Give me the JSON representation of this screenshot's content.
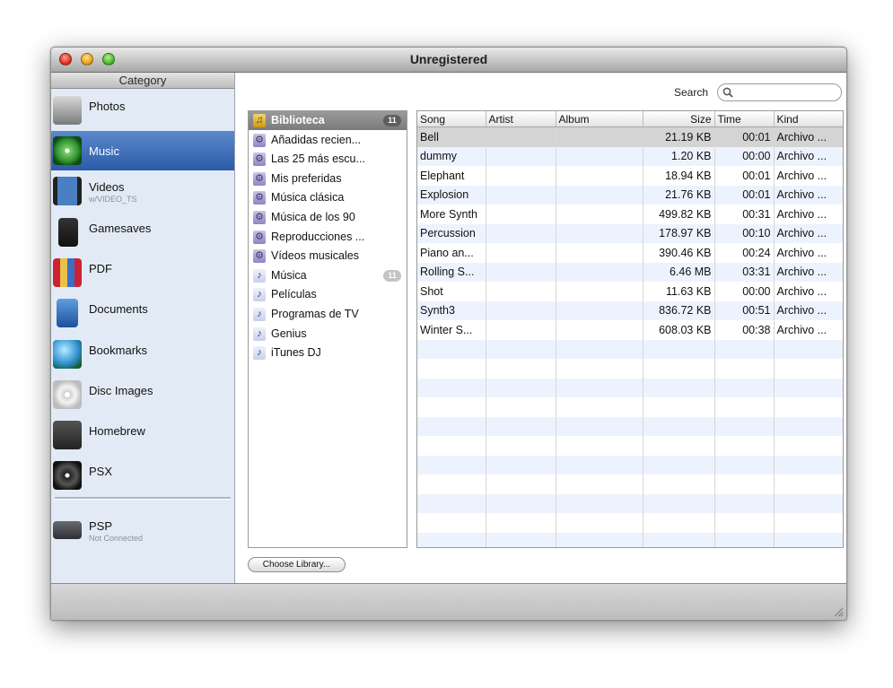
{
  "window": {
    "title": "Unregistered"
  },
  "sidebar": {
    "header": "Category",
    "items": [
      {
        "label": "Photos",
        "sublabel": "",
        "icon": "camera-icon"
      },
      {
        "label": "Music",
        "sublabel": "",
        "icon": "music-cd-icon",
        "selected": true
      },
      {
        "label": "Videos",
        "sublabel": "w/VIDEO_TS",
        "icon": "film-icon"
      },
      {
        "label": "Gamesaves",
        "sublabel": "",
        "icon": "memory-card-icon"
      },
      {
        "label": "PDF",
        "sublabel": "",
        "icon": "books-icon"
      },
      {
        "label": "Documents",
        "sublabel": "",
        "icon": "document-icon"
      },
      {
        "label": "Bookmarks",
        "sublabel": "",
        "icon": "globe-icon"
      },
      {
        "label": "Disc Images",
        "sublabel": "",
        "icon": "disc-icon"
      },
      {
        "label": "Homebrew",
        "sublabel": "",
        "icon": "clapper-icon"
      },
      {
        "label": "PSX",
        "sublabel": "",
        "icon": "vinyl-disc-icon"
      }
    ],
    "device": {
      "label": "PSP",
      "sublabel": "Not Connected",
      "icon": "psp-icon"
    }
  },
  "search": {
    "label": "Search",
    "value": "",
    "placeholder": ""
  },
  "library": {
    "items": [
      {
        "label": "Biblioteca",
        "badge": "11",
        "type": "library",
        "selected": true
      },
      {
        "label": "Añadidas recien...",
        "type": "smart"
      },
      {
        "label": "Las 25 más escu...",
        "type": "smart"
      },
      {
        "label": "Mis preferidas",
        "type": "smart"
      },
      {
        "label": "Música clásica",
        "type": "smart"
      },
      {
        "label": "Música de los 90",
        "type": "smart"
      },
      {
        "label": "Reproducciones ...",
        "type": "smart"
      },
      {
        "label": "Vídeos musicales",
        "type": "smart"
      },
      {
        "label": "Música",
        "badge": "11",
        "type": "playlist"
      },
      {
        "label": "Películas",
        "type": "playlist"
      },
      {
        "label": "Programas de TV",
        "type": "playlist"
      },
      {
        "label": "Genius",
        "type": "playlist"
      },
      {
        "label": "iTunes DJ",
        "type": "playlist"
      }
    ],
    "choose_button": "Choose Library..."
  },
  "table": {
    "columns": [
      "Song",
      "Artist",
      "Album",
      "Size",
      "Time",
      "Kind"
    ],
    "rows": [
      [
        "Bell",
        "",
        "",
        "21.19 KB",
        "00:01",
        "Archivo ..."
      ],
      [
        "dummy",
        "",
        "",
        "1.20 KB",
        "00:00",
        "Archivo ..."
      ],
      [
        "Elephant",
        "",
        "",
        "18.94 KB",
        "00:01",
        "Archivo ..."
      ],
      [
        "Explosion",
        "",
        "",
        "21.76 KB",
        "00:01",
        "Archivo ..."
      ],
      [
        "More Synth",
        "",
        "",
        "499.82 KB",
        "00:31",
        "Archivo ..."
      ],
      [
        "Percussion",
        "",
        "",
        "178.97 KB",
        "00:10",
        "Archivo ..."
      ],
      [
        "Piano an...",
        "",
        "",
        "390.46 KB",
        "00:24",
        "Archivo ..."
      ],
      [
        "Rolling S...",
        "",
        "",
        "6.46 MB",
        "03:31",
        "Archivo ..."
      ],
      [
        "Shot",
        "",
        "",
        "11.63 KB",
        "00:00",
        "Archivo ..."
      ],
      [
        "Synth3",
        "",
        "",
        "836.72 KB",
        "00:51",
        "Archivo ..."
      ],
      [
        "Winter S...",
        "",
        "",
        "608.03 KB",
        "00:38",
        "Archivo ..."
      ]
    ],
    "selected_row": 0
  }
}
